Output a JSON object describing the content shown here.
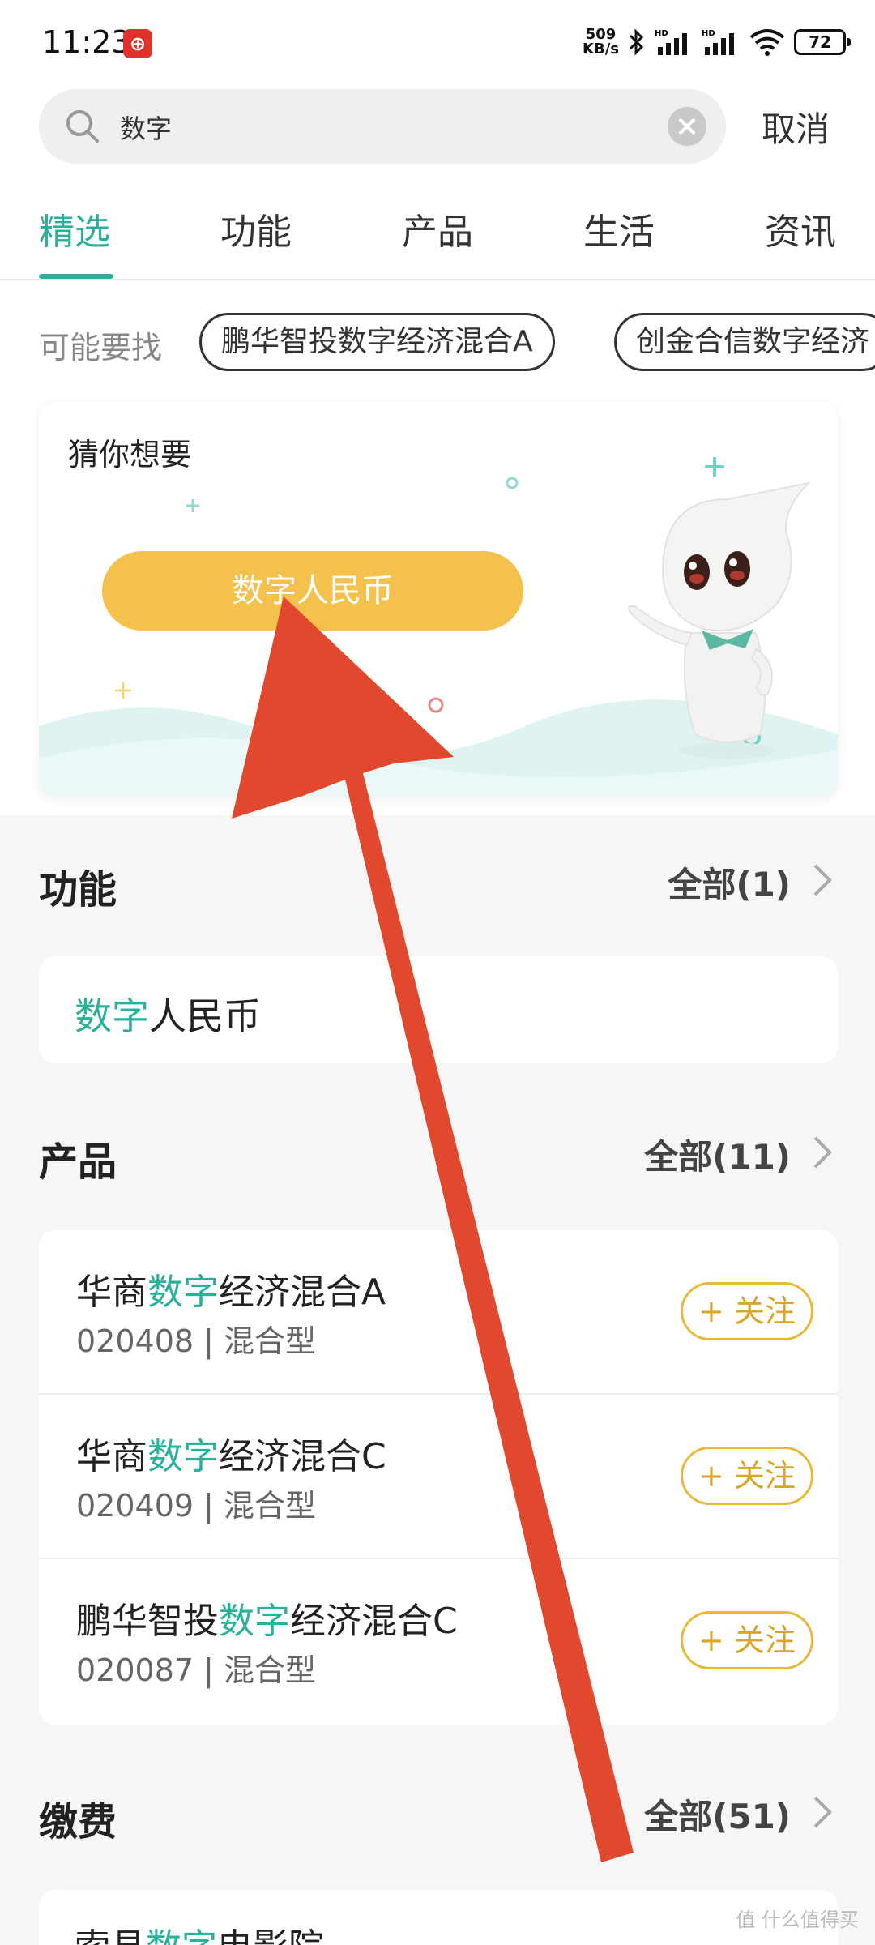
{
  "status_bar": {
    "time": "11:23",
    "app_icon_glyph": "⊕",
    "net_speed_value": "509",
    "net_speed_unit": "KB/s",
    "battery": "72"
  },
  "search": {
    "value": "数字",
    "cancel_label": "取消"
  },
  "tabs": [
    {
      "label": "精选",
      "active": true
    },
    {
      "label": "功能",
      "active": false
    },
    {
      "label": "产品",
      "active": false
    },
    {
      "label": "生活",
      "active": false
    },
    {
      "label": "资讯",
      "active": false
    }
  ],
  "maybe": {
    "label": "可能要找",
    "chips": [
      "鹏华智投数字经济混合A",
      "创金合信数字经济"
    ]
  },
  "guess": {
    "title": "猜你想要",
    "button_label": "数字人民币"
  },
  "function_section": {
    "title": "功能",
    "all_label": "全部(1)",
    "item_highlight": "数字",
    "item_rest": "人民币"
  },
  "product_section": {
    "title": "产品",
    "all_label": "全部(11)",
    "follow_label": "+ 关注",
    "items": [
      {
        "prefix": "华商",
        "highlight": "数字",
        "suffix": "经济混合A",
        "code": "020408",
        "type": "混合型"
      },
      {
        "prefix": "华商",
        "highlight": "数字",
        "suffix": "经济混合C",
        "code": "020409",
        "type": "混合型"
      },
      {
        "prefix": "鹏华智投",
        "highlight": "数字",
        "suffix": "经济混合C",
        "code": "020087",
        "type": "混合型"
      }
    ]
  },
  "payment_section": {
    "title": "缴费",
    "all_label": "全部(51)",
    "first_item_prefix": "索县",
    "first_item_highlight": "数字",
    "first_item_suffix": "电影院"
  },
  "watermark": "值 什么值得买",
  "colors": {
    "accent": "#2bb09a",
    "guess_button": "#f4c14d",
    "follow": "#e8b93a",
    "arrow": "#e2482d"
  }
}
